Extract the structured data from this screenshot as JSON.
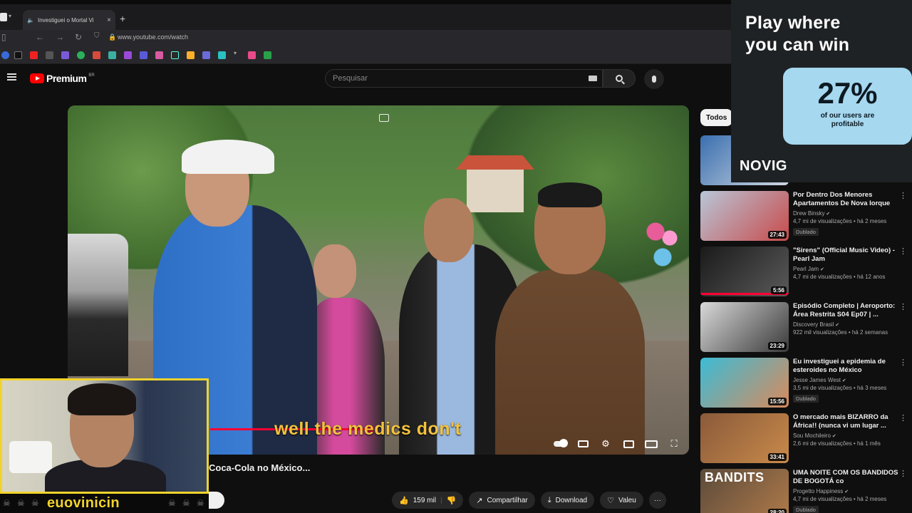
{
  "browser": {
    "tab_title": "Investiguei o Mortal Vi",
    "tab_close": "×",
    "new_tab": "+",
    "url": "www.youtube.com/watch"
  },
  "youtube": {
    "logo_text": "Premium",
    "logo_superscript": "BR",
    "search_placeholder": "Pesquisar",
    "video_title": "Coca-Cola no México...",
    "subtitle_text": "well the medics don't",
    "actions": {
      "likes": "159 mil",
      "share": "Compartilhar",
      "download": "Download",
      "thanks": "Valeu",
      "more": "···"
    }
  },
  "sidebar": {
    "chip_all": "Todos",
    "items": [
      {
        "title": "Por Dentro Dos Menores Apartamentos De Nova Iorque",
        "channel": "Drew Binsky",
        "meta": "4,7 mi de visualizações • há 2 meses",
        "badge": "Dublado",
        "duration": "27:43",
        "colors": [
          "#b8c6d8",
          "#c84b4b"
        ]
      },
      {
        "title": "\"Sirens\" (Official Music Video) - Pearl Jam",
        "channel": "Pearl Jam",
        "meta": "4,7 mi de visualizações • há 12 anos",
        "badge": "",
        "duration": "5:56",
        "colors": [
          "#1a1a1a",
          "#5a5a5a"
        ]
      },
      {
        "title": "Episódio Completo | Aeroporto: Área Restrita S04 Ep07 | ...",
        "channel": "Discovery Brasil",
        "meta": "922 mil visualizações • há 2 semanas",
        "badge": "",
        "duration": "23:29",
        "colors": [
          "#d9d9d9",
          "#3a3a3a"
        ]
      },
      {
        "title": "Eu investiguei a epidemia de esteroides no México",
        "channel": "Jesse James West",
        "meta": "3,5 mi de visualizações • há 3 meses",
        "badge": "Dublado",
        "duration": "15:56",
        "colors": [
          "#3bbcd6",
          "#d98a5c"
        ]
      },
      {
        "title": "O mercado mais BIZARRO da África!! (nunca vi um lugar ...",
        "channel": "Sou Mochileiro",
        "meta": "2,6 mi de visualizações • há 1 mês",
        "badge": "",
        "duration": "33:41",
        "colors": [
          "#8a5a3a",
          "#c98a4a"
        ]
      },
      {
        "title": "UMA NOITE COM OS BANDIDOS DE BOGOTÁ co",
        "channel": "Progetto Happiness",
        "meta": "4,7 mi de visualizações • há 2 meses",
        "badge": "Dublado",
        "duration": "28:20",
        "thumb_text": "BANDITS",
        "colors": [
          "#5a4a3a",
          "#b07a4a"
        ]
      }
    ]
  },
  "ad": {
    "headline_line1": "Play where",
    "headline_line2": "you can win",
    "stat": "27%",
    "stat_caption_line1": "of our users are",
    "stat_caption_line2": "profitable",
    "brand": "NOVIG"
  },
  "webcam": {
    "label": "euovinicin"
  },
  "theme": {
    "accent_red": "#ff0033",
    "subtitle_yellow": "#f3c23c",
    "webcam_border": "#f2d32b",
    "ad_card": "#a6d8f0"
  }
}
